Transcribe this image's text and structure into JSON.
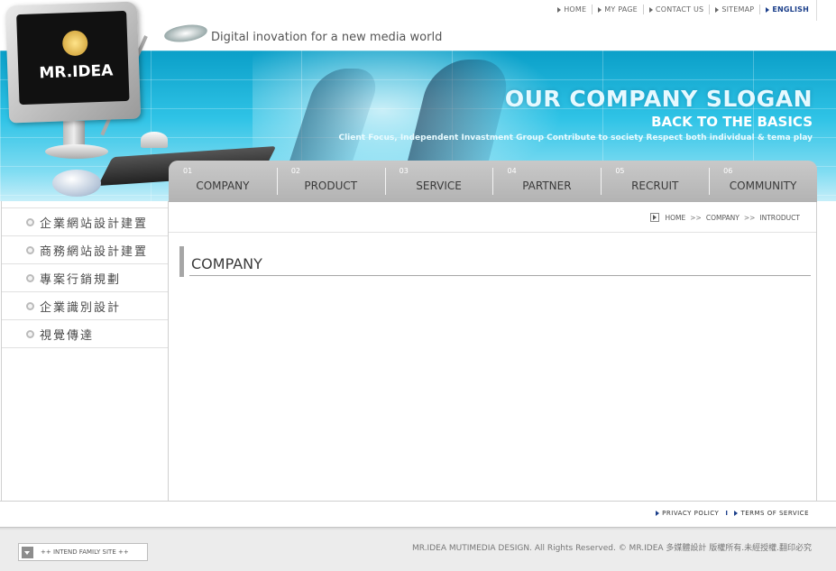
{
  "top_links": {
    "home": "HOME",
    "my_page": "MY PAGE",
    "contact_us": "CONTACT US",
    "sitemap": "SITEMAP",
    "english": "ENGLISH"
  },
  "tagline": "Digital inovation for a new media world",
  "logo": "MR.IDEA",
  "slogan": {
    "line1": "OUR COMPANY SLOGAN",
    "line2": "BACK TO THE BASICS",
    "line3": "Client Focus, Independent Invastment Group Contribute to society Respect both individual & tema play"
  },
  "nav": [
    {
      "num": "01",
      "label": "COMPANY"
    },
    {
      "num": "02",
      "label": "PRODUCT"
    },
    {
      "num": "03",
      "label": "SERVICE"
    },
    {
      "num": "04",
      "label": "PARTNER"
    },
    {
      "num": "05",
      "label": "RECRUIT"
    },
    {
      "num": "06",
      "label": "COMMUNITY"
    }
  ],
  "side_menu": [
    "企業網站設計建置",
    "商務網站設計建置",
    "專案行銷規劃",
    "企業識別設計",
    "視覺傳達"
  ],
  "breadcrumb": {
    "home": "HOME",
    "sep": ">>",
    "section": "COMPANY",
    "page": "INTRODUCT"
  },
  "page_title": "COMPANY",
  "footer": {
    "privacy": "PRIVACY POLICY",
    "sep": "I",
    "terms": "TERMS OF SERVICE",
    "family_site": "++ INTEND FAMILY SITE ++",
    "copyright": "MR.IDEA MUTIMEDIA DESIGN. All Rights Reserved. © MR.IDEA 多媒體設計 版權所有.未經授權.翻印必究"
  }
}
